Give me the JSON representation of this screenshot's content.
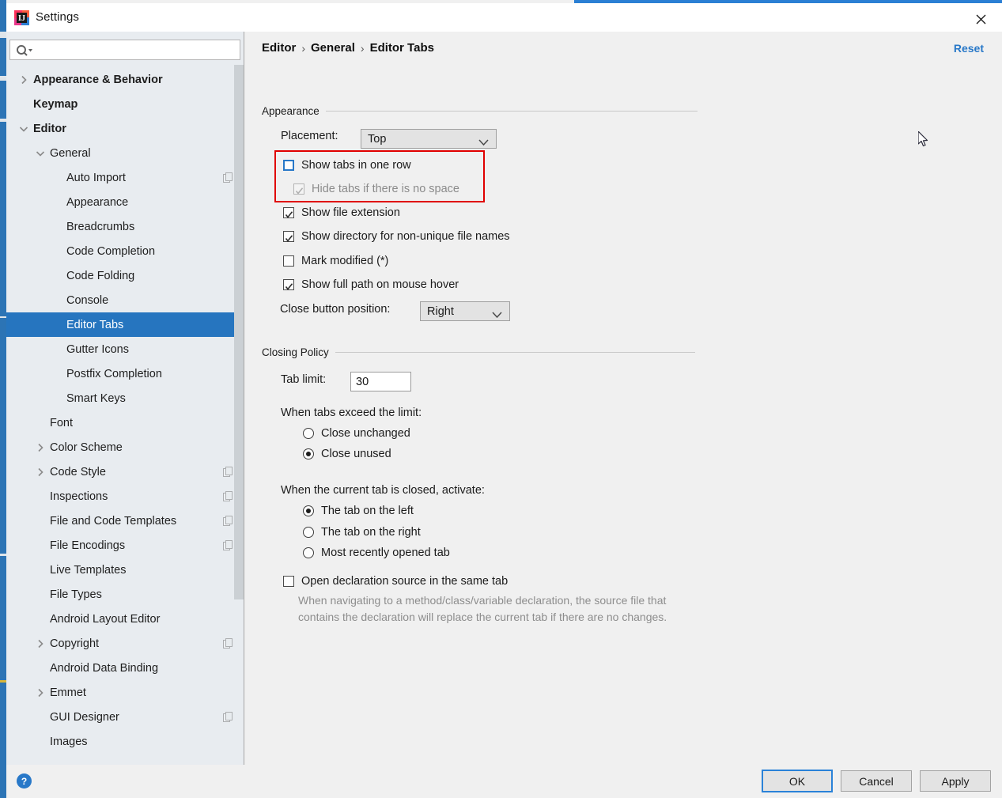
{
  "window": {
    "title": "Settings",
    "app_icon": "intellij-idea-icon",
    "close_icon": "close-icon"
  },
  "sidebar": {
    "search": {
      "placeholder": "",
      "value": "",
      "icon": "search-icon"
    },
    "items": [
      {
        "label": "Appearance & Behavior",
        "indent": 0,
        "twisty": "collapsed",
        "bold": true,
        "badge": false,
        "selected": false
      },
      {
        "label": "Keymap",
        "indent": 0,
        "twisty": "none",
        "bold": true,
        "badge": false,
        "selected": false
      },
      {
        "label": "Editor",
        "indent": 0,
        "twisty": "expanded",
        "bold": true,
        "badge": false,
        "selected": false
      },
      {
        "label": "General",
        "indent": 1,
        "twisty": "expanded",
        "bold": false,
        "badge": false,
        "selected": false
      },
      {
        "label": "Auto Import",
        "indent": 2,
        "twisty": "none",
        "bold": false,
        "badge": true,
        "selected": false
      },
      {
        "label": "Appearance",
        "indent": 2,
        "twisty": "none",
        "bold": false,
        "badge": false,
        "selected": false
      },
      {
        "label": "Breadcrumbs",
        "indent": 2,
        "twisty": "none",
        "bold": false,
        "badge": false,
        "selected": false
      },
      {
        "label": "Code Completion",
        "indent": 2,
        "twisty": "none",
        "bold": false,
        "badge": false,
        "selected": false
      },
      {
        "label": "Code Folding",
        "indent": 2,
        "twisty": "none",
        "bold": false,
        "badge": false,
        "selected": false
      },
      {
        "label": "Console",
        "indent": 2,
        "twisty": "none",
        "bold": false,
        "badge": false,
        "selected": false
      },
      {
        "label": "Editor Tabs",
        "indent": 2,
        "twisty": "none",
        "bold": false,
        "badge": false,
        "selected": true
      },
      {
        "label": "Gutter Icons",
        "indent": 2,
        "twisty": "none",
        "bold": false,
        "badge": false,
        "selected": false
      },
      {
        "label": "Postfix Completion",
        "indent": 2,
        "twisty": "none",
        "bold": false,
        "badge": false,
        "selected": false
      },
      {
        "label": "Smart Keys",
        "indent": 2,
        "twisty": "none",
        "bold": false,
        "badge": false,
        "selected": false
      },
      {
        "label": "Font",
        "indent": 1,
        "twisty": "none",
        "bold": false,
        "badge": false,
        "selected": false
      },
      {
        "label": "Color Scheme",
        "indent": 1,
        "twisty": "collapsed",
        "bold": false,
        "badge": false,
        "selected": false
      },
      {
        "label": "Code Style",
        "indent": 1,
        "twisty": "collapsed",
        "bold": false,
        "badge": true,
        "selected": false
      },
      {
        "label": "Inspections",
        "indent": 1,
        "twisty": "none",
        "bold": false,
        "badge": true,
        "selected": false
      },
      {
        "label": "File and Code Templates",
        "indent": 1,
        "twisty": "none",
        "bold": false,
        "badge": true,
        "selected": false
      },
      {
        "label": "File Encodings",
        "indent": 1,
        "twisty": "none",
        "bold": false,
        "badge": true,
        "selected": false
      },
      {
        "label": "Live Templates",
        "indent": 1,
        "twisty": "none",
        "bold": false,
        "badge": false,
        "selected": false
      },
      {
        "label": "File Types",
        "indent": 1,
        "twisty": "none",
        "bold": false,
        "badge": false,
        "selected": false
      },
      {
        "label": "Android Layout Editor",
        "indent": 1,
        "twisty": "none",
        "bold": false,
        "badge": false,
        "selected": false
      },
      {
        "label": "Copyright",
        "indent": 1,
        "twisty": "collapsed",
        "bold": false,
        "badge": true,
        "selected": false
      },
      {
        "label": "Android Data Binding",
        "indent": 1,
        "twisty": "none",
        "bold": false,
        "badge": false,
        "selected": false
      },
      {
        "label": "Emmet",
        "indent": 1,
        "twisty": "collapsed",
        "bold": false,
        "badge": false,
        "selected": false
      },
      {
        "label": "GUI Designer",
        "indent": 1,
        "twisty": "none",
        "bold": false,
        "badge": true,
        "selected": false
      },
      {
        "label": "Images",
        "indent": 1,
        "twisty": "none",
        "bold": false,
        "badge": false,
        "selected": false
      }
    ]
  },
  "content": {
    "breadcrumb": {
      "items": [
        "Editor",
        "General",
        "Editor Tabs"
      ],
      "separator": "›"
    },
    "reset_label": "Reset",
    "appearance": {
      "group_title": "Appearance",
      "placement_label": "Placement:",
      "placement_value": "Top",
      "show_tabs_one_row": {
        "label": "Show tabs in one row",
        "checked": false,
        "focused": true
      },
      "hide_tabs_no_space": {
        "label": "Hide tabs if there is no space",
        "checked": true,
        "disabled": true
      },
      "show_file_extension": {
        "label": "Show file extension",
        "checked": true
      },
      "show_directory": {
        "label": "Show directory for non-unique file names",
        "checked": true
      },
      "mark_modified": {
        "label": "Mark modified (*)",
        "checked": false
      },
      "show_full_path": {
        "label": "Show full path on mouse hover",
        "checked": true
      },
      "close_button_label": "Close button position:",
      "close_button_value": "Right"
    },
    "closing_policy": {
      "group_title": "Closing Policy",
      "tab_limit_label": "Tab limit:",
      "tab_limit_value": "30",
      "exceed_label": "When tabs exceed the limit:",
      "exceed_options": [
        {
          "label": "Close unchanged",
          "selected": false
        },
        {
          "label": "Close unused",
          "selected": true
        }
      ],
      "activate_label": "When the current tab is closed, activate:",
      "activate_options": [
        {
          "label": "The tab on the left",
          "selected": true
        },
        {
          "label": "The tab on the right",
          "selected": false
        },
        {
          "label": "Most recently opened tab",
          "selected": false
        }
      ],
      "open_declaration": {
        "label": "Open declaration source in the same tab",
        "checked": false
      },
      "open_declaration_hint": "When navigating to a method/class/variable declaration, the source file that contains the declaration will replace the current tab if there are no changes."
    }
  },
  "footer": {
    "help_icon": "help-icon",
    "ok_label": "OK",
    "cancel_label": "Cancel",
    "apply_label": "Apply"
  },
  "colors": {
    "selection_blue": "#2675bf",
    "link_blue": "#2878c8",
    "focus_blue": "#2a82d8",
    "annotation_red": "#e00000",
    "sidebar_bg": "#e8ecf0",
    "panel_bg": "#f0f0f0"
  }
}
